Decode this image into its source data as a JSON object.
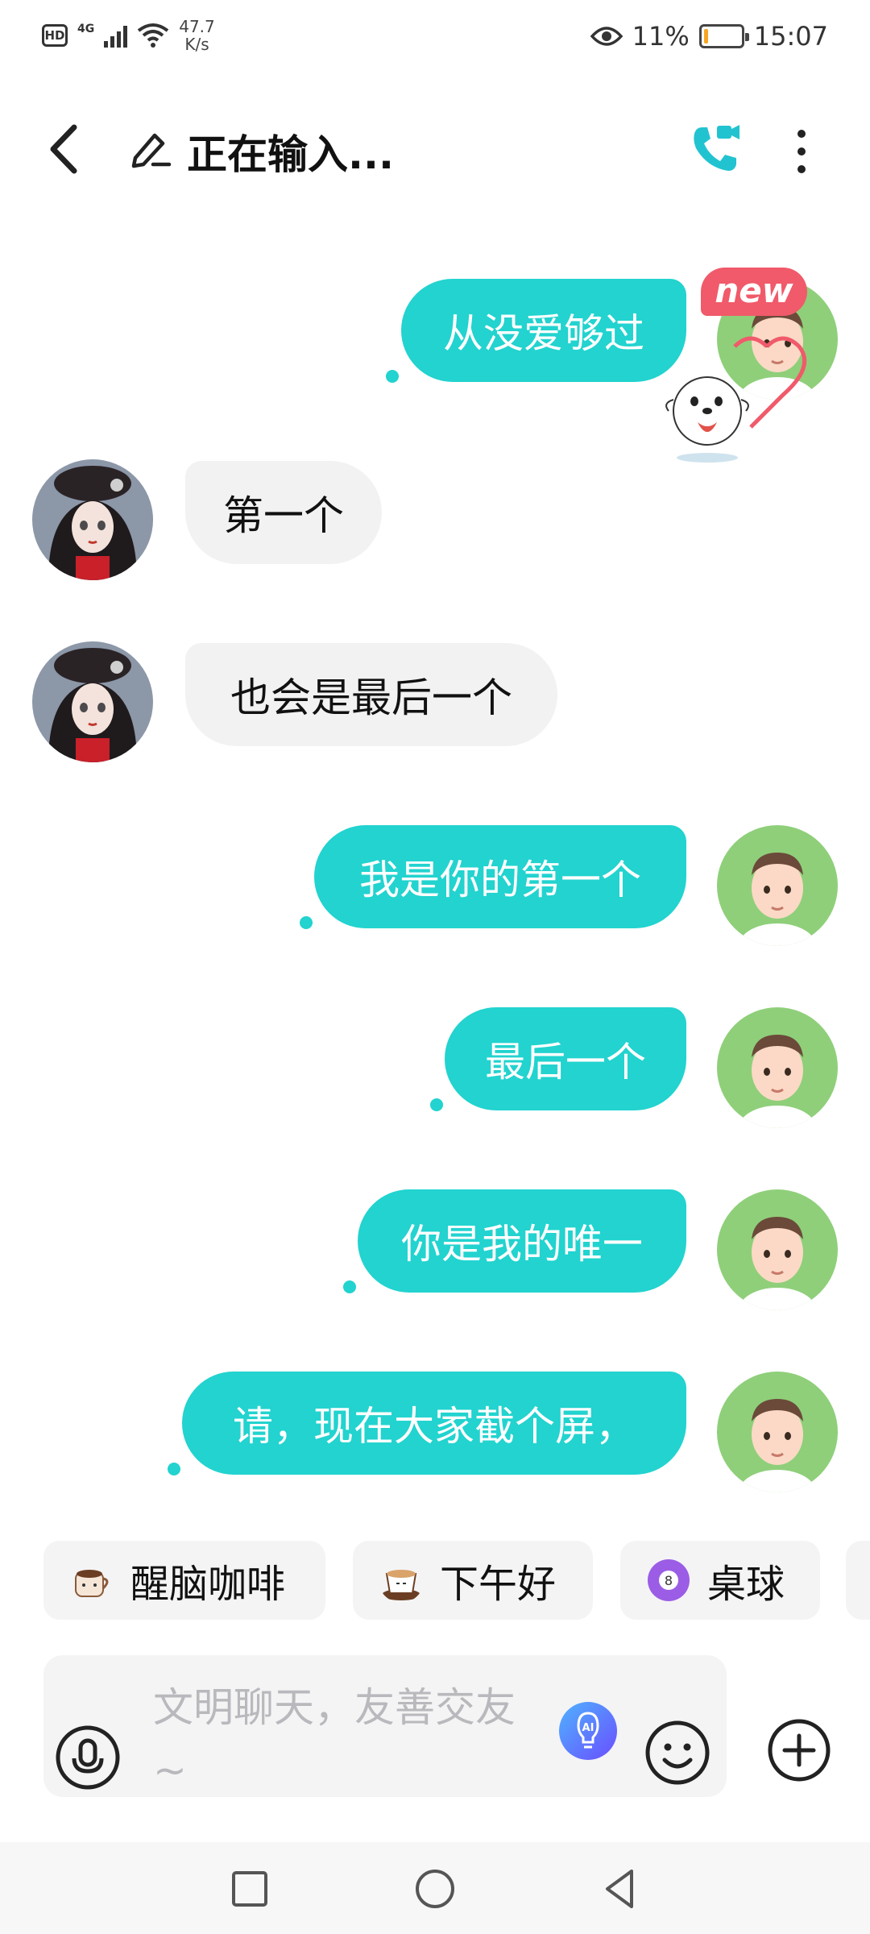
{
  "status_bar": {
    "hd_label": "HD",
    "network_type": "4G",
    "speed_value": "47.7",
    "speed_unit": "K/s",
    "battery_percent": "11%",
    "battery_level": 0.11,
    "time": "15:07"
  },
  "header": {
    "title": "正在输入...",
    "icons": [
      "back-arrow",
      "pencil-typing",
      "video-call",
      "more-vertical"
    ]
  },
  "messages": [
    {
      "direction": "outgoing",
      "text": "从没爱够过",
      "badge": "new"
    },
    {
      "direction": "incoming",
      "text": "第一个"
    },
    {
      "direction": "incoming",
      "text": "也会是最后一个"
    },
    {
      "direction": "outgoing",
      "text": "我是你的第一个"
    },
    {
      "direction": "outgoing",
      "text": "最后一个"
    },
    {
      "direction": "outgoing",
      "text": "你是我的唯一"
    },
    {
      "direction": "outgoing",
      "text": "请，现在大家截个屏，"
    }
  ],
  "quick_chips": [
    {
      "label": "醒脑咖啡",
      "icon": "coffee-cup"
    },
    {
      "label": "下午好",
      "icon": "latte"
    },
    {
      "label": "桌球",
      "icon": "billiard-8-ball"
    }
  ],
  "input": {
    "placeholder": "文明聊天，友善交友~"
  },
  "colors": {
    "accent": "#22d3cf",
    "incoming_bubble": "#f2f2f3",
    "new_badge": "#f05a6a",
    "placeholder": "#b9b9bd"
  }
}
